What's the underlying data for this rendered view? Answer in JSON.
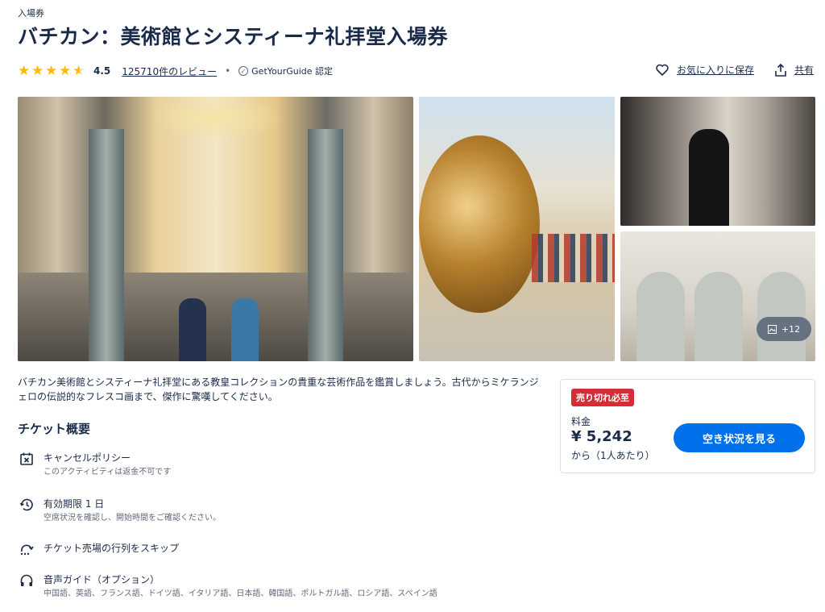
{
  "header": {
    "category": "入場券",
    "title": "バチカン：美術館とシスティーナ礼拝堂入場券"
  },
  "rating": {
    "score": "4.5",
    "stars": 4.5,
    "reviews_label": "125710件のレビュー",
    "certified_label": "GetYourGuide 認定"
  },
  "actions": {
    "wishlist_label": "お気に入りに保存",
    "share_label": "共有"
  },
  "gallery": {
    "more_label": "+12"
  },
  "description": "バチカン美術館とシスティーナ礼拝堂にある教皇コレクションの貴重な芸術作品を鑑賞しましょう。古代からミケランジェロの伝説的なフレスコ画まで、傑作に驚嘆してください。",
  "overview": {
    "title": "チケット概要",
    "features": [
      {
        "icon": "calendar-x-icon",
        "title": "キャンセルポリシー",
        "subtitle": "このアクティビティは返金不可です"
      },
      {
        "icon": "clock-history-icon",
        "title": "有効期限 1 日",
        "subtitle": "空席状況を確認し、開始時間をご確認ください。"
      },
      {
        "icon": "skip-line-icon",
        "title": "チケット売場の行列をスキップ",
        "subtitle": ""
      },
      {
        "icon": "headphones-icon",
        "title": "音声ガイド（オプション）",
        "subtitle": "中国語、英語、フランス語、ドイツ語、イタリア語、日本語、韓国語、ポルトガル語、ロシア語、スペイン語"
      }
    ]
  },
  "booking": {
    "badge": "売り切れ必至",
    "price_label": "料金",
    "price": "¥ 5,242",
    "per_person": "から（1人あたり）",
    "button_label": "空き状況を見る"
  },
  "colors": {
    "primary_text": "#1a2b49",
    "star": "#fdbb02",
    "badge": "#d42d36",
    "button": "#0071eb"
  }
}
